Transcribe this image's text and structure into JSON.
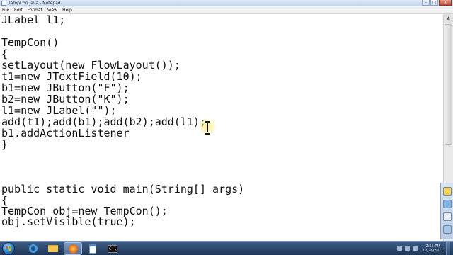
{
  "window": {
    "title": "TempCon.java - Notepad",
    "controls": {
      "minimize": "–",
      "maximize": "□",
      "close": "x"
    }
  },
  "menu": {
    "items": [
      "File",
      "Edit",
      "Format",
      "View",
      "Help"
    ]
  },
  "editor": {
    "lines": [
      "JLabel l1;",
      "",
      "TempCon()",
      "{",
      "setLayout(new FlowLayout());",
      "t1=new JTextField(10);",
      "b1=new JButton(\"F\");",
      "b2=new JButton(\"K\");",
      "l1=new JLabel(\"\");",
      "add(t1);add(b1);add(b2);add(l1);",
      "b1.addActionListener",
      "}",
      "",
      "",
      "",
      "public static void main(String[] args)",
      "{",
      "TempCon obj=new TempCon();",
      "obj.setVisible(true);"
    ]
  },
  "taskbar": {
    "buttons": [
      {
        "name": "internet-explorer",
        "icon": "ie-icon"
      },
      {
        "name": "windows-explorer",
        "icon": "folder-icon"
      },
      {
        "name": "media-player",
        "icon": "media-icon",
        "active": true
      },
      {
        "name": "notepad",
        "icon": "notepad-icon"
      },
      {
        "name": "xp-mode",
        "icon": "window-icon"
      },
      {
        "name": "command-prompt",
        "icon": "cmd-icon",
        "label": "C:\\"
      }
    ],
    "clock": {
      "time": "2:55 PM",
      "date": "12/26/2011"
    }
  },
  "colors": {
    "taskbar": "#1e3657",
    "title_bar": "#c4d5ea",
    "editor_bg": "#ffffff",
    "text": "#111111"
  }
}
